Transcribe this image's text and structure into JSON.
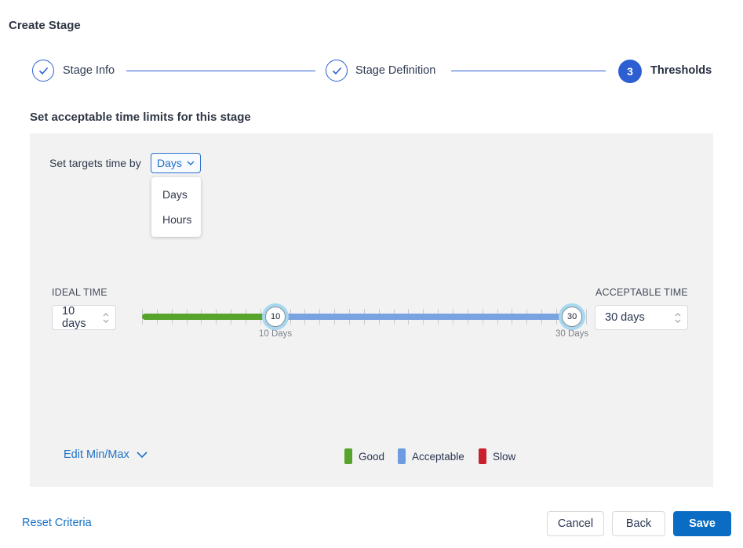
{
  "page": {
    "title": "Create Stage"
  },
  "stepper": {
    "steps": [
      {
        "label": "Stage Info",
        "state": "complete"
      },
      {
        "label": "Stage Definition",
        "state": "complete"
      },
      {
        "label": "Thresholds",
        "state": "current",
        "number": "3"
      }
    ]
  },
  "content": {
    "heading": "Set acceptable time limits for this stage"
  },
  "targets": {
    "label": "Set targets time by",
    "selected": "Days",
    "menu_options": [
      "Days",
      "Hours"
    ]
  },
  "thresholds": {
    "ideal_label": "IDEAL TIME",
    "ideal_value": "10 days",
    "acceptable_label": "ACCEPTABLE TIME",
    "acceptable_value": "30 days",
    "slider": {
      "range_min": 1,
      "range_max": 31,
      "tick_count": 31,
      "min_handle": {
        "value": 10,
        "label": "10 Days"
      },
      "max_handle": {
        "value": 30,
        "label": "30 Days"
      },
      "good_color": "#56a42c",
      "acceptable_color": "#7ba2e0"
    }
  },
  "legend": {
    "items": [
      {
        "label": "Good",
        "color": "#56a42c"
      },
      {
        "label": "Acceptable",
        "color": "#6f9ce0"
      },
      {
        "label": "Slow",
        "color": "#c9202e"
      }
    ]
  },
  "edit_minmax_label": "Edit Min/Max",
  "footer": {
    "reset_label": "Reset Criteria",
    "cancel_label": "Cancel",
    "back_label": "Back",
    "save_label": "Save",
    "save_color": "#0b6cc4",
    "accent_blue": "#2d5fd3"
  }
}
